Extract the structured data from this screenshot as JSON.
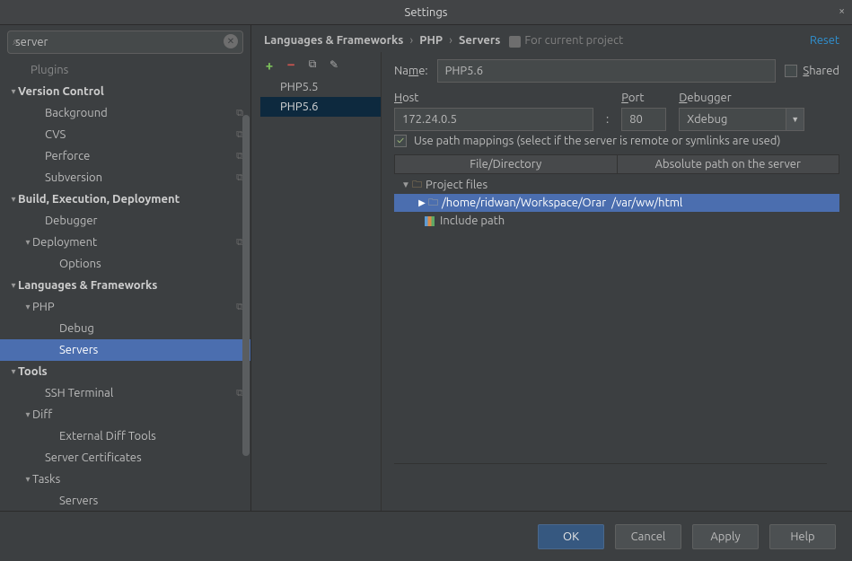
{
  "title": "Settings",
  "search": {
    "value": "server"
  },
  "sidebar": {
    "rows": [
      {
        "label": "Plugins",
        "indent": 24,
        "caret": "",
        "bold": false,
        "badge": false,
        "dim": true
      },
      {
        "label": "Version Control",
        "indent": 10,
        "caret": "▾",
        "bold": true,
        "badge": false
      },
      {
        "label": "Background",
        "indent": 40,
        "caret": "",
        "bold": false,
        "badge": true
      },
      {
        "label": "CVS",
        "indent": 40,
        "caret": "",
        "bold": false,
        "badge": true
      },
      {
        "label": "Perforce",
        "indent": 40,
        "caret": "",
        "bold": false,
        "badge": true
      },
      {
        "label": "Subversion",
        "indent": 40,
        "caret": "",
        "bold": false,
        "badge": true
      },
      {
        "label": "Build, Execution, Deployment",
        "indent": 10,
        "caret": "▾",
        "bold": true,
        "badge": false
      },
      {
        "label": "Debugger",
        "indent": 40,
        "caret": "",
        "bold": false,
        "badge": false
      },
      {
        "label": "Deployment",
        "indent": 26,
        "caret": "▾",
        "bold": false,
        "badge": true
      },
      {
        "label": "Options",
        "indent": 56,
        "caret": "",
        "bold": false,
        "badge": false
      },
      {
        "label": "Languages & Frameworks",
        "indent": 10,
        "caret": "▾",
        "bold": true,
        "badge": false
      },
      {
        "label": "PHP",
        "indent": 26,
        "caret": "▾",
        "bold": false,
        "badge": true
      },
      {
        "label": "Debug",
        "indent": 56,
        "caret": "",
        "bold": false,
        "badge": false
      },
      {
        "label": "Servers",
        "indent": 56,
        "caret": "",
        "bold": false,
        "badge": false,
        "selected": true
      },
      {
        "label": "Tools",
        "indent": 10,
        "caret": "▾",
        "bold": true,
        "badge": false
      },
      {
        "label": "SSH Terminal",
        "indent": 40,
        "caret": "",
        "bold": false,
        "badge": true
      },
      {
        "label": "Diff",
        "indent": 26,
        "caret": "▾",
        "bold": false,
        "badge": false
      },
      {
        "label": "External Diff Tools",
        "indent": 56,
        "caret": "",
        "bold": false,
        "badge": false
      },
      {
        "label": "Server Certificates",
        "indent": 40,
        "caret": "",
        "bold": false,
        "badge": false
      },
      {
        "label": "Tasks",
        "indent": 26,
        "caret": "▾",
        "bold": false,
        "badge": false
      },
      {
        "label": "Servers",
        "indent": 56,
        "caret": "",
        "bold": false,
        "badge": false
      }
    ]
  },
  "breadcrumb": {
    "a": "Languages & Frameworks",
    "b": "PHP",
    "c": "Servers",
    "scope": "For current project",
    "reset": "Reset"
  },
  "servers": [
    {
      "name": "PHP5.5",
      "selected": false
    },
    {
      "name": "PHP5.6",
      "selected": true
    }
  ],
  "form": {
    "name_label": "Name:",
    "name_value": "PHP5.6",
    "shared_label": "Shared",
    "host_label": "Host",
    "host_value": "172.24.0.5",
    "port_label": "Port",
    "port_value": "80",
    "debugger_label": "Debugger",
    "debugger_value": "Xdebug",
    "pathmap_label": "Use path mappings (select if the server is remote or symlinks are used)",
    "col1": "File/Directory",
    "col2": "Absolute path on the server",
    "tree": {
      "project_files": "Project files",
      "local_path": "/home/ridwan/Workspace/Orar",
      "remote_path": "/var/ww/html",
      "include_path": "Include path"
    }
  },
  "buttons": {
    "ok": "OK",
    "cancel": "Cancel",
    "apply": "Apply",
    "help": "Help"
  }
}
